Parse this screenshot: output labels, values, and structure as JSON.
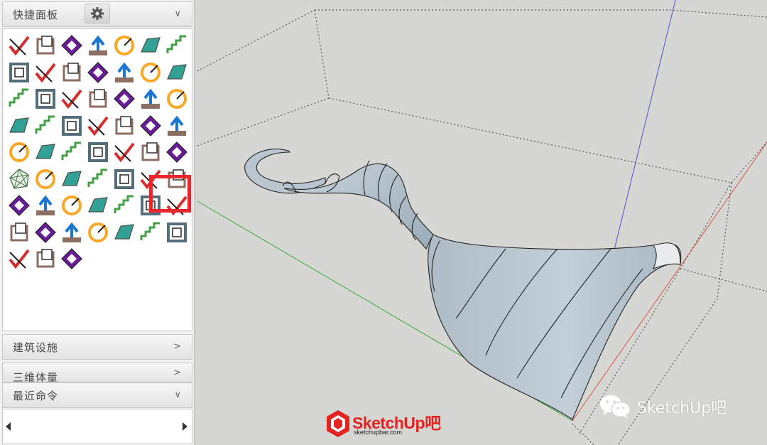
{
  "panel": {
    "quick_panel_title": "快捷面板",
    "sections": {
      "architecture": "建筑设施",
      "three_d_volume": "三维体量",
      "recent_commands": "最近命令"
    },
    "tool_icons": [
      "check-lines-tool",
      "check-edges-tool",
      "mirror-tool",
      "curved-surface-tool",
      "planes-tool",
      "blue-tile-tool",
      "green-cubes-tool",
      "hex-box-tool",
      "explode-arrows-tool",
      "quad-face-tool",
      "stairs-tool",
      "ruler-tool",
      "terrain-tool",
      "drape-tool",
      "grid-tool",
      "cabinet-tool",
      "polyline-tool",
      "triangle-tool",
      "red-diamond-tool",
      "lock-shape-tool",
      "spiral-tool",
      "axis-tool",
      "red-roll-tool",
      "frame-tool",
      "corner-tool",
      "arc-bridge-tool",
      "wood-block-tool",
      "square-frame-tool",
      "paint-cone-tool",
      "book-tool",
      "wall-tool",
      "push-pull-up-tool",
      "north-arrow-tool",
      "shell-tool",
      "curve-dot-tool",
      "mesh-wireframe-tool",
      "brick-tool",
      "gold-block-tool",
      "sword-tool",
      "ice-cube-tool",
      "dot-grid-tool",
      "red-dot-grid-tool",
      "axes-tool",
      "folder-stack-tool",
      "cursor-arc-tool",
      "box-pair-tool",
      "green-diamond-tool",
      "diagonal-tool",
      "pipe-tool",
      "pot-tool",
      "rail-tool",
      "branch-tool",
      "extrude-j-tool",
      "stove-tool",
      "rotate-cursor-tool",
      "beam-tool",
      "blue-shard-tool",
      "outline-diamond-tool",
      "w-plus-tool"
    ],
    "highlighted_tool": "mesh-wireframe-tool"
  },
  "watermark": {
    "logo_text": "SketchUp吧",
    "logo_url": "sketchupbar.com",
    "wechat_text": "SketchUp吧"
  },
  "colors": {
    "viewport_bg": "#d6d6d3",
    "highlight_box": "#e8262d",
    "shape_fill": "#aebdc8",
    "axis_red": "#e04040",
    "axis_green": "#3aaa3a",
    "axis_blue": "#4a4ad0"
  }
}
